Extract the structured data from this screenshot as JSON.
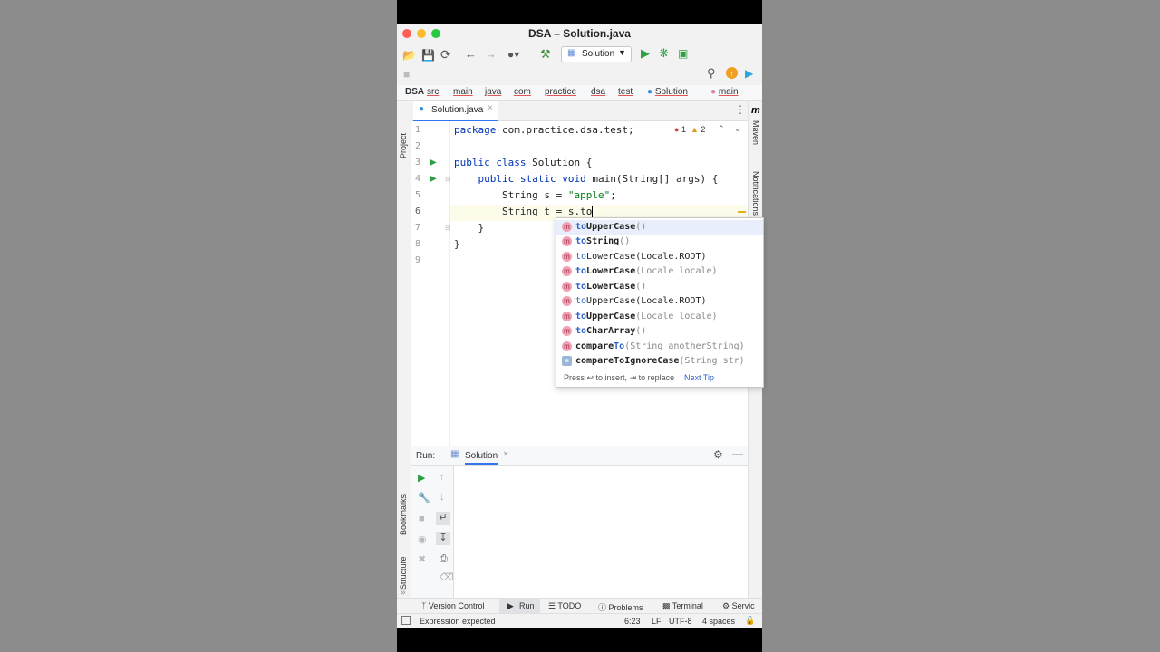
{
  "window": {
    "title": "DSA – Solution.java"
  },
  "toolbar": {
    "run_config": "Solution"
  },
  "breadcrumb": {
    "project": "DSA",
    "items": [
      "src",
      "main",
      "java",
      "com",
      "practice",
      "dsa",
      "test",
      "Solution",
      "main"
    ]
  },
  "side_tools": {
    "project": "Project",
    "bookmarks": "Bookmarks",
    "structure": "Structure",
    "maven": "Maven",
    "notifications": "Notifications"
  },
  "editor": {
    "tab_label": "Solution.java",
    "error_count": "1",
    "warning_count": "2",
    "line_numbers": [
      "1",
      "2",
      "3",
      "4",
      "5",
      "6",
      "7",
      "8",
      "9"
    ]
  },
  "completion": {
    "items": [
      {
        "match": "to",
        "rest": "UpperCase",
        "sig": "()"
      },
      {
        "match": "to",
        "rest": "String",
        "sig": "()"
      },
      {
        "match": "to",
        "rest": "LowerCase(Locale.ROOT)",
        "sig": ""
      },
      {
        "match": "to",
        "rest": "LowerCase",
        "sig": "(Locale locale)"
      },
      {
        "match": "to",
        "rest": "LowerCase",
        "sig": "()"
      },
      {
        "match": "to",
        "rest": "UpperCase(Locale.ROOT)",
        "sig": ""
      },
      {
        "match": "to",
        "rest": "UpperCase",
        "sig": "(Locale locale)"
      },
      {
        "match": "to",
        "rest": "CharArray",
        "sig": "()"
      },
      {
        "match": "compare",
        "rest": "To",
        "sig": "(String anotherString)"
      },
      {
        "match": "compare",
        "rest": "ToIgnoreCase",
        "sig": "(String str)"
      }
    ],
    "footer_hint": "Press ↩ to insert, ⇥ to replace",
    "next_tip": "Next Tip"
  },
  "run_panel": {
    "label": "Run:",
    "tab": "Solution"
  },
  "bottom_tabs": [
    "Version Control",
    "Run",
    "TODO",
    "Problems",
    "Terminal",
    "Servic"
  ],
  "status": {
    "message": "Expression expected",
    "position": "6:23",
    "line_sep": "LF",
    "encoding": "UTF-8",
    "indent": "4 spaces"
  }
}
